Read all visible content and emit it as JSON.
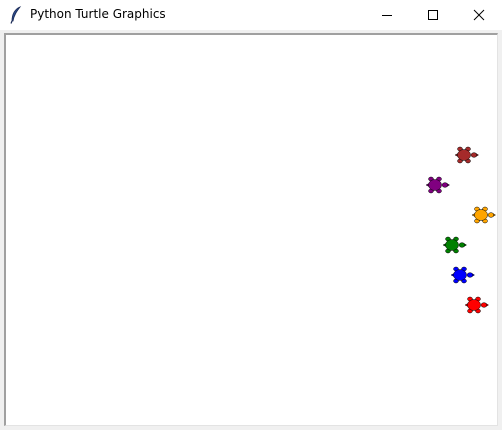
{
  "window": {
    "title": "Python Turtle Graphics"
  },
  "title_controls": {
    "minimize": "minimize",
    "maximize": "maximize",
    "close": "close"
  },
  "turtles": [
    {
      "name": "brown",
      "color": "#a52a2a",
      "heading": "east"
    },
    {
      "name": "purple",
      "color": "#800080",
      "heading": "east"
    },
    {
      "name": "orange",
      "color": "#ffa500",
      "heading": "east"
    },
    {
      "name": "green",
      "color": "#008000",
      "heading": "east"
    },
    {
      "name": "blue",
      "color": "#0000ff",
      "heading": "east"
    },
    {
      "name": "red",
      "color": "#ff0000",
      "heading": "east"
    }
  ]
}
